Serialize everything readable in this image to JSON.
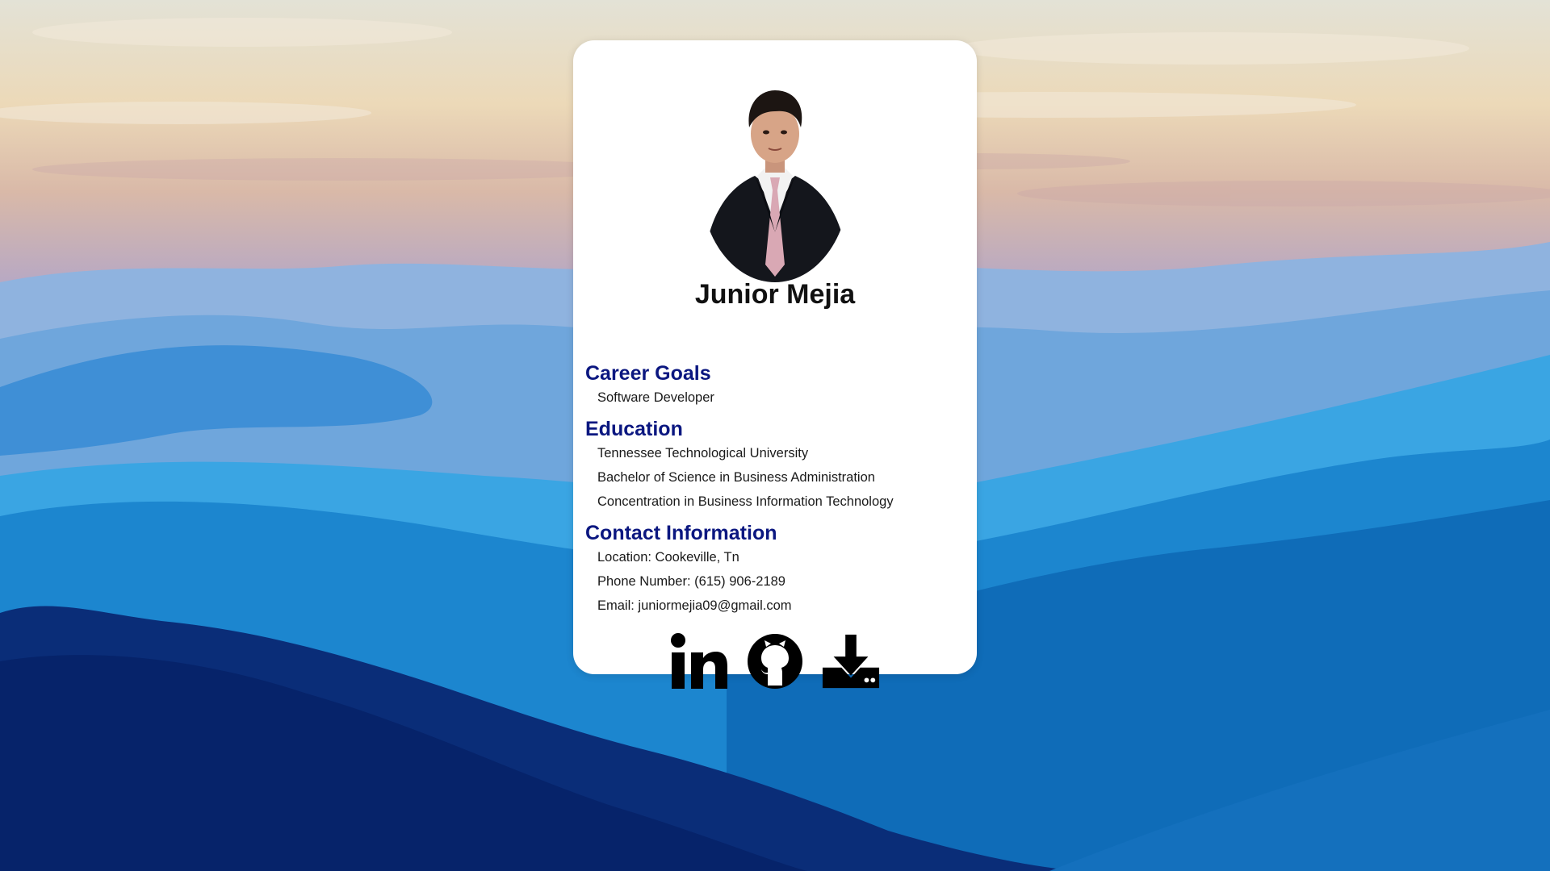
{
  "profile": {
    "name": "Junior Mejia",
    "photo_alt": "profile-photo"
  },
  "career": {
    "heading": "Career Goals",
    "items": [
      "Software Developer"
    ]
  },
  "education": {
    "heading": "Education",
    "items": [
      "Tennessee Technological University",
      "Bachelor of Science in Business Administration",
      "Concentration in Business Information Technology"
    ]
  },
  "contact": {
    "heading": "Contact Information",
    "items": [
      "Location: Cookeville, Tn",
      "Phone Number: (615) 906-2189",
      "Email: juniormejia09@gmail.com"
    ]
  },
  "links": [
    {
      "icon": "linkedin-icon"
    },
    {
      "icon": "github-icon"
    },
    {
      "icon": "download-icon"
    }
  ],
  "colors": {
    "heading": "#0b1780",
    "card": "#ffffff",
    "sky_top": "#dcdcd0",
    "sky_mid": "#e8c9a0",
    "mountain_light": "#4bb0e8",
    "mountain_dark": "#06266b"
  }
}
